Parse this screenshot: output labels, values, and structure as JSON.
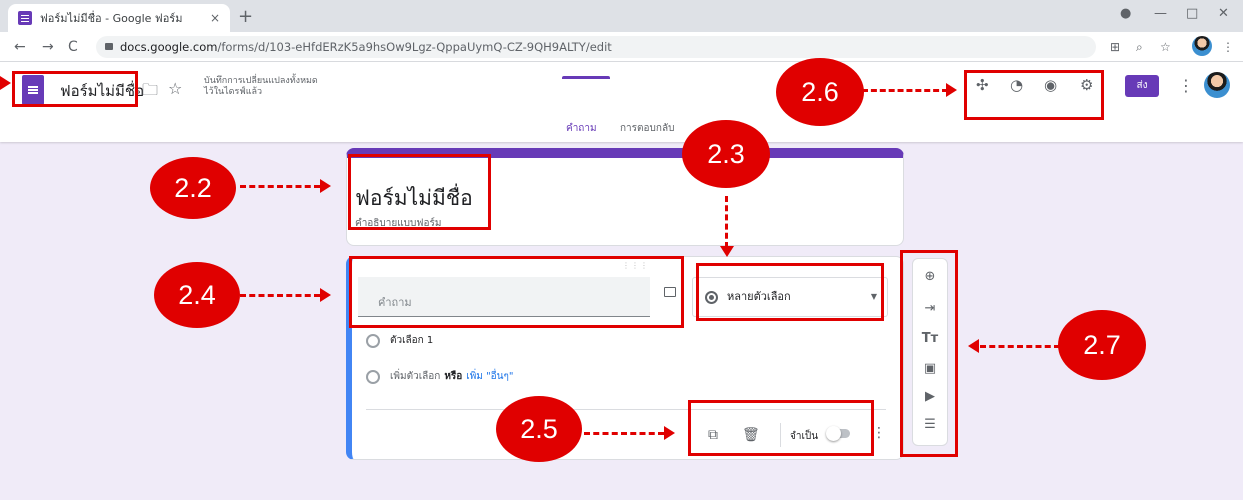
{
  "browser": {
    "tab_title": "ฟอร์มไม่มีชื่อ - Google ฟอร์ม",
    "tab_close": "×",
    "new_tab": "+",
    "url_host": "docs.google.com",
    "url_path": "/forms/d/103-eHfdERzK5a9hsOw9Lgz-QppaUymQ-CZ-9QH9ALTY/edit",
    "back": "←",
    "forward": "→",
    "reload": "C"
  },
  "header": {
    "title": "ฟอร์มไม่มีชื่อ",
    "saved_line1": "บันทึกการเปลี่ยนแปลงทั้งหมด",
    "saved_line2": "ไว้ในไดรฟ์แล้ว",
    "send_label": "ส่ง",
    "tabs": [
      "คำถาม",
      "การตอบกลับ"
    ]
  },
  "form": {
    "title": "ฟอร์มไม่มีชื่อ",
    "description": "คำอธิบายแบบฟอร์ม"
  },
  "question": {
    "placeholder": "คำถาม",
    "type": "หลายตัวเลือก",
    "option1": "ตัวเลือก 1",
    "add_option": "เพิ่มตัวเลือก",
    "or": "หรือ",
    "add_other": "เพิ่ม \"อื่นๆ\"",
    "required_label": "จำเป็น"
  },
  "annotations": [
    "2.2",
    "2.3",
    "2.4",
    "2.5",
    "2.6",
    "2.7"
  ],
  "colors": {
    "accent": "#673ab7",
    "annotation": "#e00000",
    "background": "#f0ebf8"
  }
}
